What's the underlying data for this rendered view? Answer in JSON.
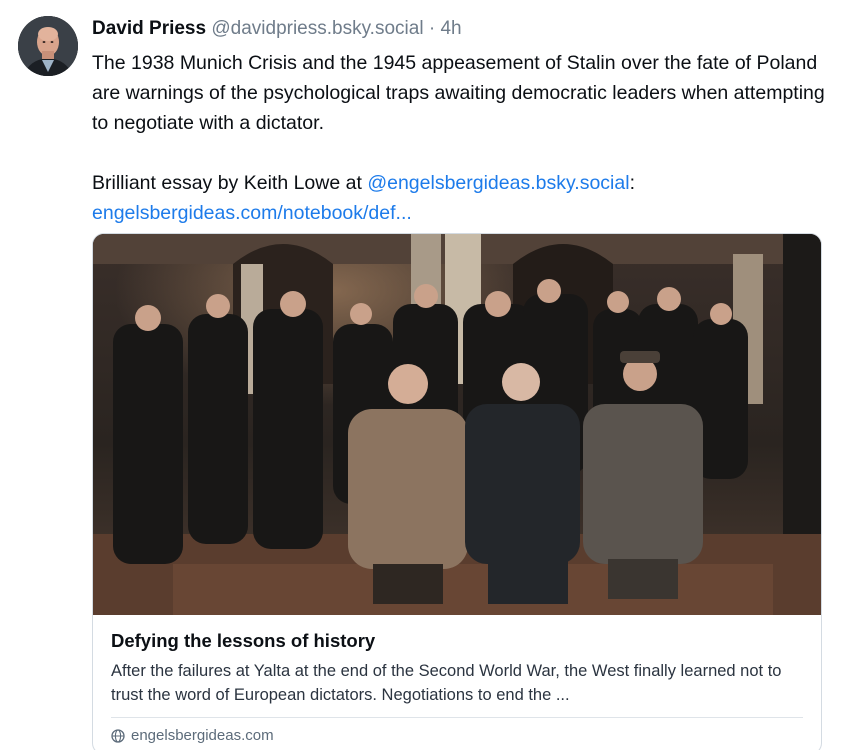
{
  "post": {
    "author": {
      "name": "David Priess",
      "handle": "@davidpriess.bsky.social",
      "separator": "·",
      "time": "4h"
    },
    "text": {
      "paragraph1": "The 1938 Munich Crisis and the 1945 appeasement of Stalin over the fate of Poland are warnings of the psychological traps awaiting democratic leaders when attempting to negotiate with a dictator.",
      "paragraph2_prefix": "Brilliant essay by Keith Lowe at ",
      "mention": "@engelsbergideas.bsky.social",
      "paragraph2_suffix": ":",
      "url": "engelsbergideas.com/notebook/def..."
    },
    "embed": {
      "title": "Defying the lessons of history",
      "description": "After the failures at Yalta at the end of the Second World War, the West finally learned not to trust the word of European dictators. Negotiations to end the ...",
      "domain": "engelsbergideas.com",
      "source_icon": "globe-icon"
    }
  },
  "colors": {
    "link": "#1d7bea",
    "muted": "#6f7c8a",
    "border": "#d4dbe2"
  }
}
